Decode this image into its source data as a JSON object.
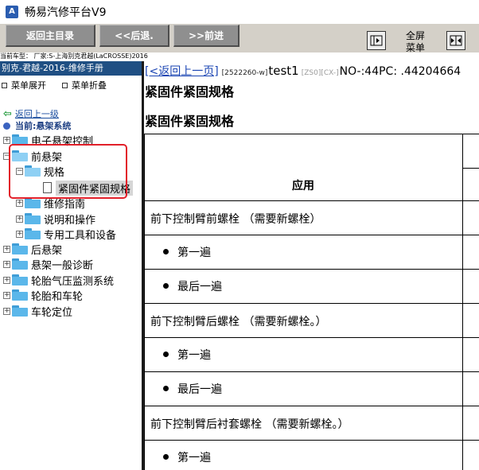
{
  "window": {
    "title": "畅易汽修平台V9",
    "logo_text": "A"
  },
  "toolbar": {
    "home_label": "返回主目录",
    "back_label": "<<后退.",
    "forward_label": ">>前进",
    "fullscreen_label_line1": "全屏",
    "fullscreen_label_line2": "菜单"
  },
  "vehicle_info": "当前车型： 厂家:S-上海别克君越(LaCROSSE)2016",
  "sidebar": {
    "header": "别克-君越-2016-维修手册",
    "expand_all": "菜单展开",
    "collapse_all": "菜单折叠",
    "up_level": "返回上一级",
    "current": "当前:悬架系统",
    "tree": [
      {
        "label": "电子悬架控制"
      },
      {
        "label": "前悬架"
      },
      {
        "label": "规格"
      },
      {
        "label": "紧固件紧固规格"
      },
      {
        "label": "维修指南"
      },
      {
        "label": "说明和操作"
      },
      {
        "label": "专用工具和设备"
      },
      {
        "label": "后悬架"
      },
      {
        "label": "悬架一般诊断"
      },
      {
        "label": "轮胎气压监测系统"
      },
      {
        "label": "轮胎和车轮"
      },
      {
        "label": "车轮定位"
      }
    ]
  },
  "content": {
    "back_link": "[<返回上一页]",
    "doc_code": "[2522260-w]",
    "doc_title": "test1",
    "grey_tag": "[ZS0][CX-]",
    "ids": "NO-:44PC: .44204664",
    "heading1": "紧固件紧固规格",
    "heading2": "紧固件紧固规格",
    "table": {
      "header_application": "应用",
      "rows": [
        {
          "text": "前下控制臂前螺栓 （需要新螺栓）",
          "bullet": false
        },
        {
          "text": "第一遍",
          "bullet": true
        },
        {
          "text": "最后一遍",
          "bullet": true
        },
        {
          "text": "前下控制臂后螺栓 （需要新螺栓。）",
          "bullet": false
        },
        {
          "text": "第一遍",
          "bullet": true
        },
        {
          "text": "最后一遍",
          "bullet": true
        },
        {
          "text": "前下控制臂后衬套螺栓 （需要新螺栓。）",
          "bullet": false
        },
        {
          "text": "第一遍",
          "bullet": true
        }
      ]
    }
  },
  "colors": {
    "toolbar_bg": "#d4d0c8",
    "button_bg": "#8f8f8f",
    "sidebar_header": "#1f4f83",
    "highlight_box": "#e2202a",
    "link": "#1a44b3"
  }
}
